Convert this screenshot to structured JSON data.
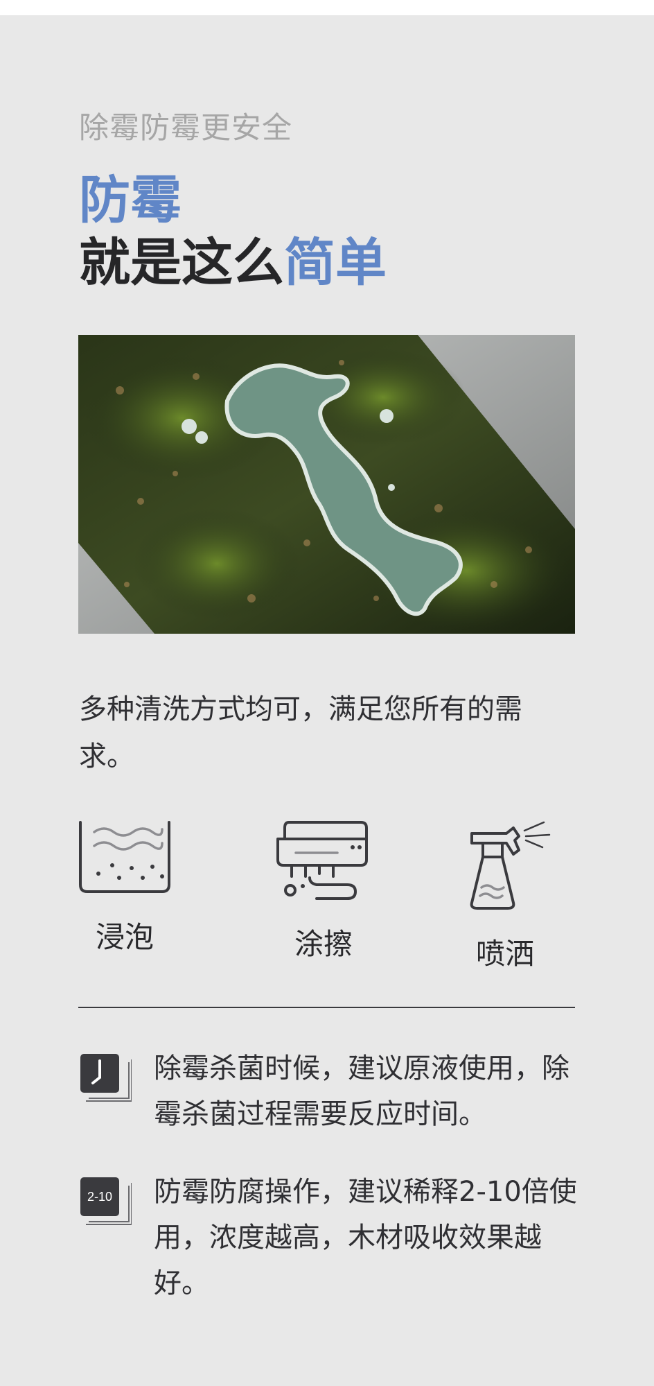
{
  "header": {
    "subtitle": "除霉防霉更安全",
    "title_line1": "防霉",
    "title_line2_prefix": "就是这么",
    "title_line2_accent": "简单"
  },
  "image": {
    "description": "mold-covered wooden log"
  },
  "description": "多种清洗方式均可，满足您所有的需求。",
  "methods": [
    {
      "label": "浸泡",
      "icon": "soak-basin-icon"
    },
    {
      "label": "涂擦",
      "icon": "brush-icon"
    },
    {
      "label": "喷洒",
      "icon": "spray-bottle-icon"
    }
  ],
  "tips": [
    {
      "icon": "clock-stack-icon",
      "badge": "",
      "text": "除霉杀菌时候，建议原液使用，除霉杀菌过程需要反应时间。"
    },
    {
      "icon": "dilution-stack-icon",
      "badge": "2-10",
      "text": "防霉防腐操作，建议稀释2-10倍使用，浓度越高，木材吸收效果越好。"
    }
  ],
  "colors": {
    "accent": "#6086c7",
    "background": "#e8e8e8",
    "text": "#2b2b2f",
    "subtitle": "#a6a6a6"
  }
}
